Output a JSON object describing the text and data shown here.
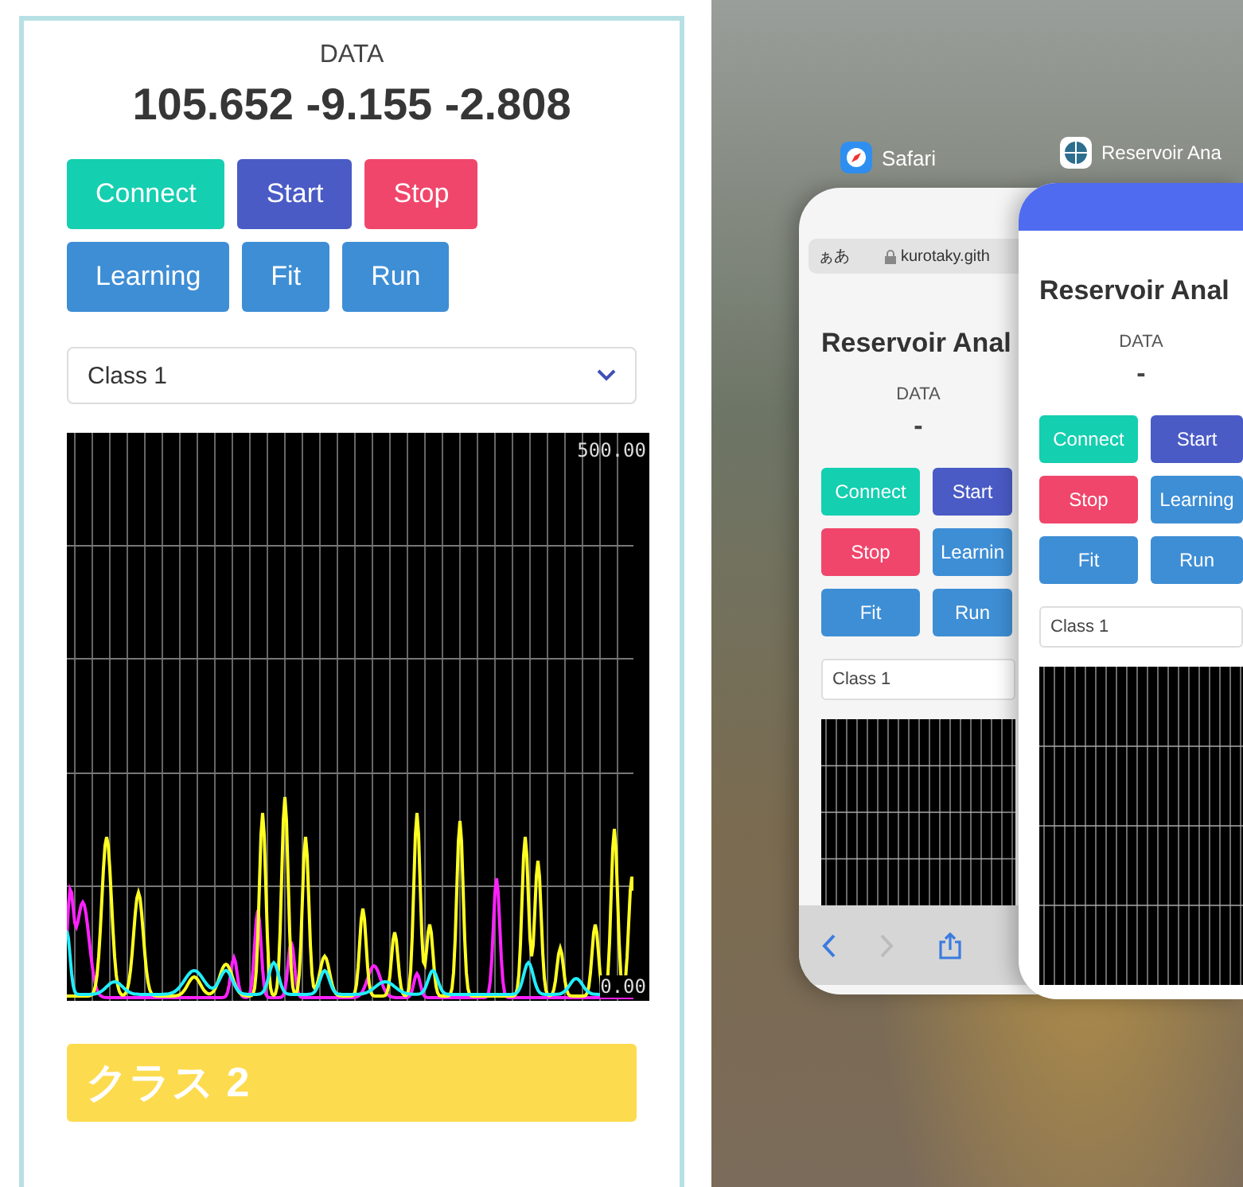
{
  "web_page": {
    "data_label": "DATA",
    "data_values": "105.652 -9.155 -2.808",
    "buttons": [
      {
        "label": "Connect",
        "kind": "success"
      },
      {
        "label": "Start",
        "kind": "primary"
      },
      {
        "label": "Stop",
        "kind": "danger"
      },
      {
        "label": "Learning",
        "kind": "info"
      },
      {
        "label": "Fit",
        "kind": "info"
      },
      {
        "label": "Run",
        "kind": "info"
      }
    ],
    "class_select": {
      "value": "Class 1"
    },
    "waveform": {
      "max_label": "500.00",
      "min_label": "0.00"
    },
    "result_banner": "クラス 2"
  },
  "app_switcher": {
    "cards": [
      {
        "kind": "browser",
        "app_name": "Safari",
        "address_prefix": "ぁあ",
        "address": "kurotaky.gith",
        "page_title": "Reservoir Anal",
        "data_label": "DATA",
        "data_values": "-",
        "buttons": [
          {
            "label": "Connect",
            "kind": "success"
          },
          {
            "label": "Start",
            "kind": "primary"
          },
          {
            "label": "Stop",
            "kind": "danger"
          },
          {
            "label": "Learnin",
            "kind": "info"
          },
          {
            "label": "Fit",
            "kind": "info"
          },
          {
            "label": "Run",
            "kind": "info"
          }
        ],
        "class_select": "Class 1"
      },
      {
        "kind": "app",
        "app_name": "Reservoir Ana",
        "page_title": "Reservoir Anal",
        "data_label": "DATA",
        "data_values": "-",
        "buttons": [
          {
            "label": "Connect",
            "kind": "success"
          },
          {
            "label": "Start",
            "kind": "primary"
          },
          {
            "label": "Stop",
            "kind": "danger"
          },
          {
            "label": "Learning",
            "kind": "info"
          },
          {
            "label": "Fit",
            "kind": "info"
          },
          {
            "label": "Run",
            "kind": "info"
          }
        ],
        "class_select": "Class 1"
      }
    ]
  }
}
